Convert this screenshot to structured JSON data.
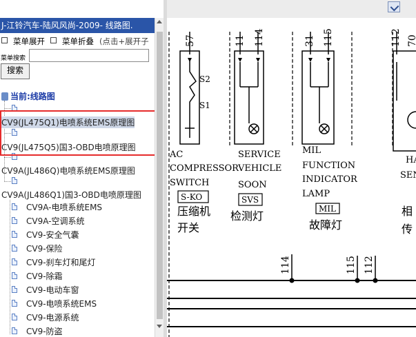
{
  "window": {
    "title": "J-江铃汽车-陆风风尚-2009- 线路图."
  },
  "menu": {
    "expand_label": "菜单展开",
    "collapse_label": "菜单折叠",
    "hint": "(点击+展开子"
  },
  "search": {
    "label": "菜单搜索",
    "value": "",
    "placeholder": "",
    "button_label": "搜索"
  },
  "tree": {
    "root_label": "当前:线路图",
    "nodes": [
      {
        "label": "CV9(JL475Q1)电喷系统EMS原理图",
        "selected": true
      },
      {
        "label": "CV9(JL475Q5)国3-OBD电喷原理图",
        "selected": false
      },
      {
        "label": "CV9A(JL486Q)电喷系统EMS原理图",
        "selected": false
      },
      {
        "label": "CV9A(JL486Q1)国3-OBD电喷原理图",
        "selected": false
      }
    ],
    "children": [
      "CV9A-电喷系统EMS",
      "CV9A-空调系统",
      "CV9-安全气囊",
      "CV9-保险",
      "CV9-刹车灯和尾灯",
      "CV9-除霜",
      "CV9-电动车窗",
      "CV9-电喷系统EMS",
      "CV9-电源系统",
      "CV9-防盗"
    ]
  },
  "diagram": {
    "components": [
      {
        "en_lines": [
          "AC",
          "COMPRESSOR",
          "SWITCH"
        ],
        "code": "S-KO",
        "zh_lines": [
          "压缩机",
          "开关"
        ],
        "parts": [
          "S2",
          "S1"
        ],
        "wire_top": "57"
      },
      {
        "en_lines": [
          "SERVICE",
          "VEHICLE",
          "SOON"
        ],
        "code": "SVS",
        "zh_lines": [
          "检测灯"
        ],
        "wire_top_a": "11",
        "wire_top_b": "114"
      },
      {
        "en_lines": [
          "MIL",
          "FUNCTION",
          "INDICATOR",
          "LAMP"
        ],
        "code": "MIL",
        "zh_lines": [
          "故障灯"
        ],
        "wire_top_a": "31",
        "wire_top_b": "115"
      },
      {
        "en_lines": [
          "HA",
          "SEN"
        ],
        "zh_lines": [
          "相",
          "传"
        ],
        "wire_top_a": "112",
        "wire_top_b": "70"
      }
    ],
    "bottom_wires": [
      "114",
      "115",
      "112"
    ]
  },
  "colors": {
    "title_bar": "#2a55a8",
    "highlight_box": "#e62b2b",
    "tree_root": "#1a3aa6"
  }
}
